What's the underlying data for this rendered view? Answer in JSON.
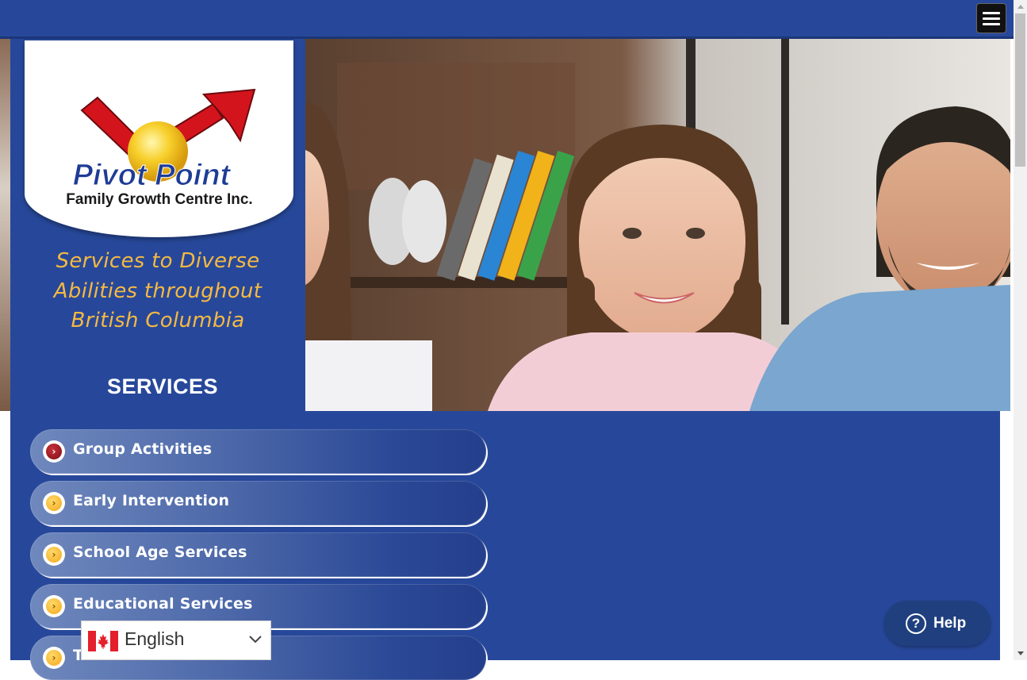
{
  "header": {
    "menu_icon": "hamburger-menu-icon"
  },
  "hero": {
    "logo": {
      "brand": "Pivot Point",
      "subtitle": "Family Growth Centre Inc."
    },
    "tagline": [
      "Services to Diverse",
      "Abilities throughout",
      "British Columbia"
    ],
    "section_heading": "SERVICES",
    "photo_alt": "family-photo"
  },
  "services": [
    {
      "label": "Group Activities",
      "icon": "chevron-right-circle-icon",
      "active": true
    },
    {
      "label": "Early Intervention",
      "icon": "chevron-right-circle-icon",
      "active": false
    },
    {
      "label": "School Age Services",
      "icon": "chevron-right-circle-icon",
      "active": false
    },
    {
      "label": "Educational Services",
      "icon": "chevron-right-circle-icon",
      "active": false
    },
    {
      "label": "T",
      "icon": "chevron-right-circle-icon",
      "active": false
    }
  ],
  "language": {
    "selected": "English",
    "flag": "canada-flag-icon"
  },
  "help": {
    "label": "Help",
    "icon": "question-circle-icon"
  },
  "colors": {
    "primary_blue": "#27489a",
    "tagline_gold": "#f5b942",
    "active_icon_red": "#7d0f16",
    "icon_gold": "#f4a81d"
  }
}
